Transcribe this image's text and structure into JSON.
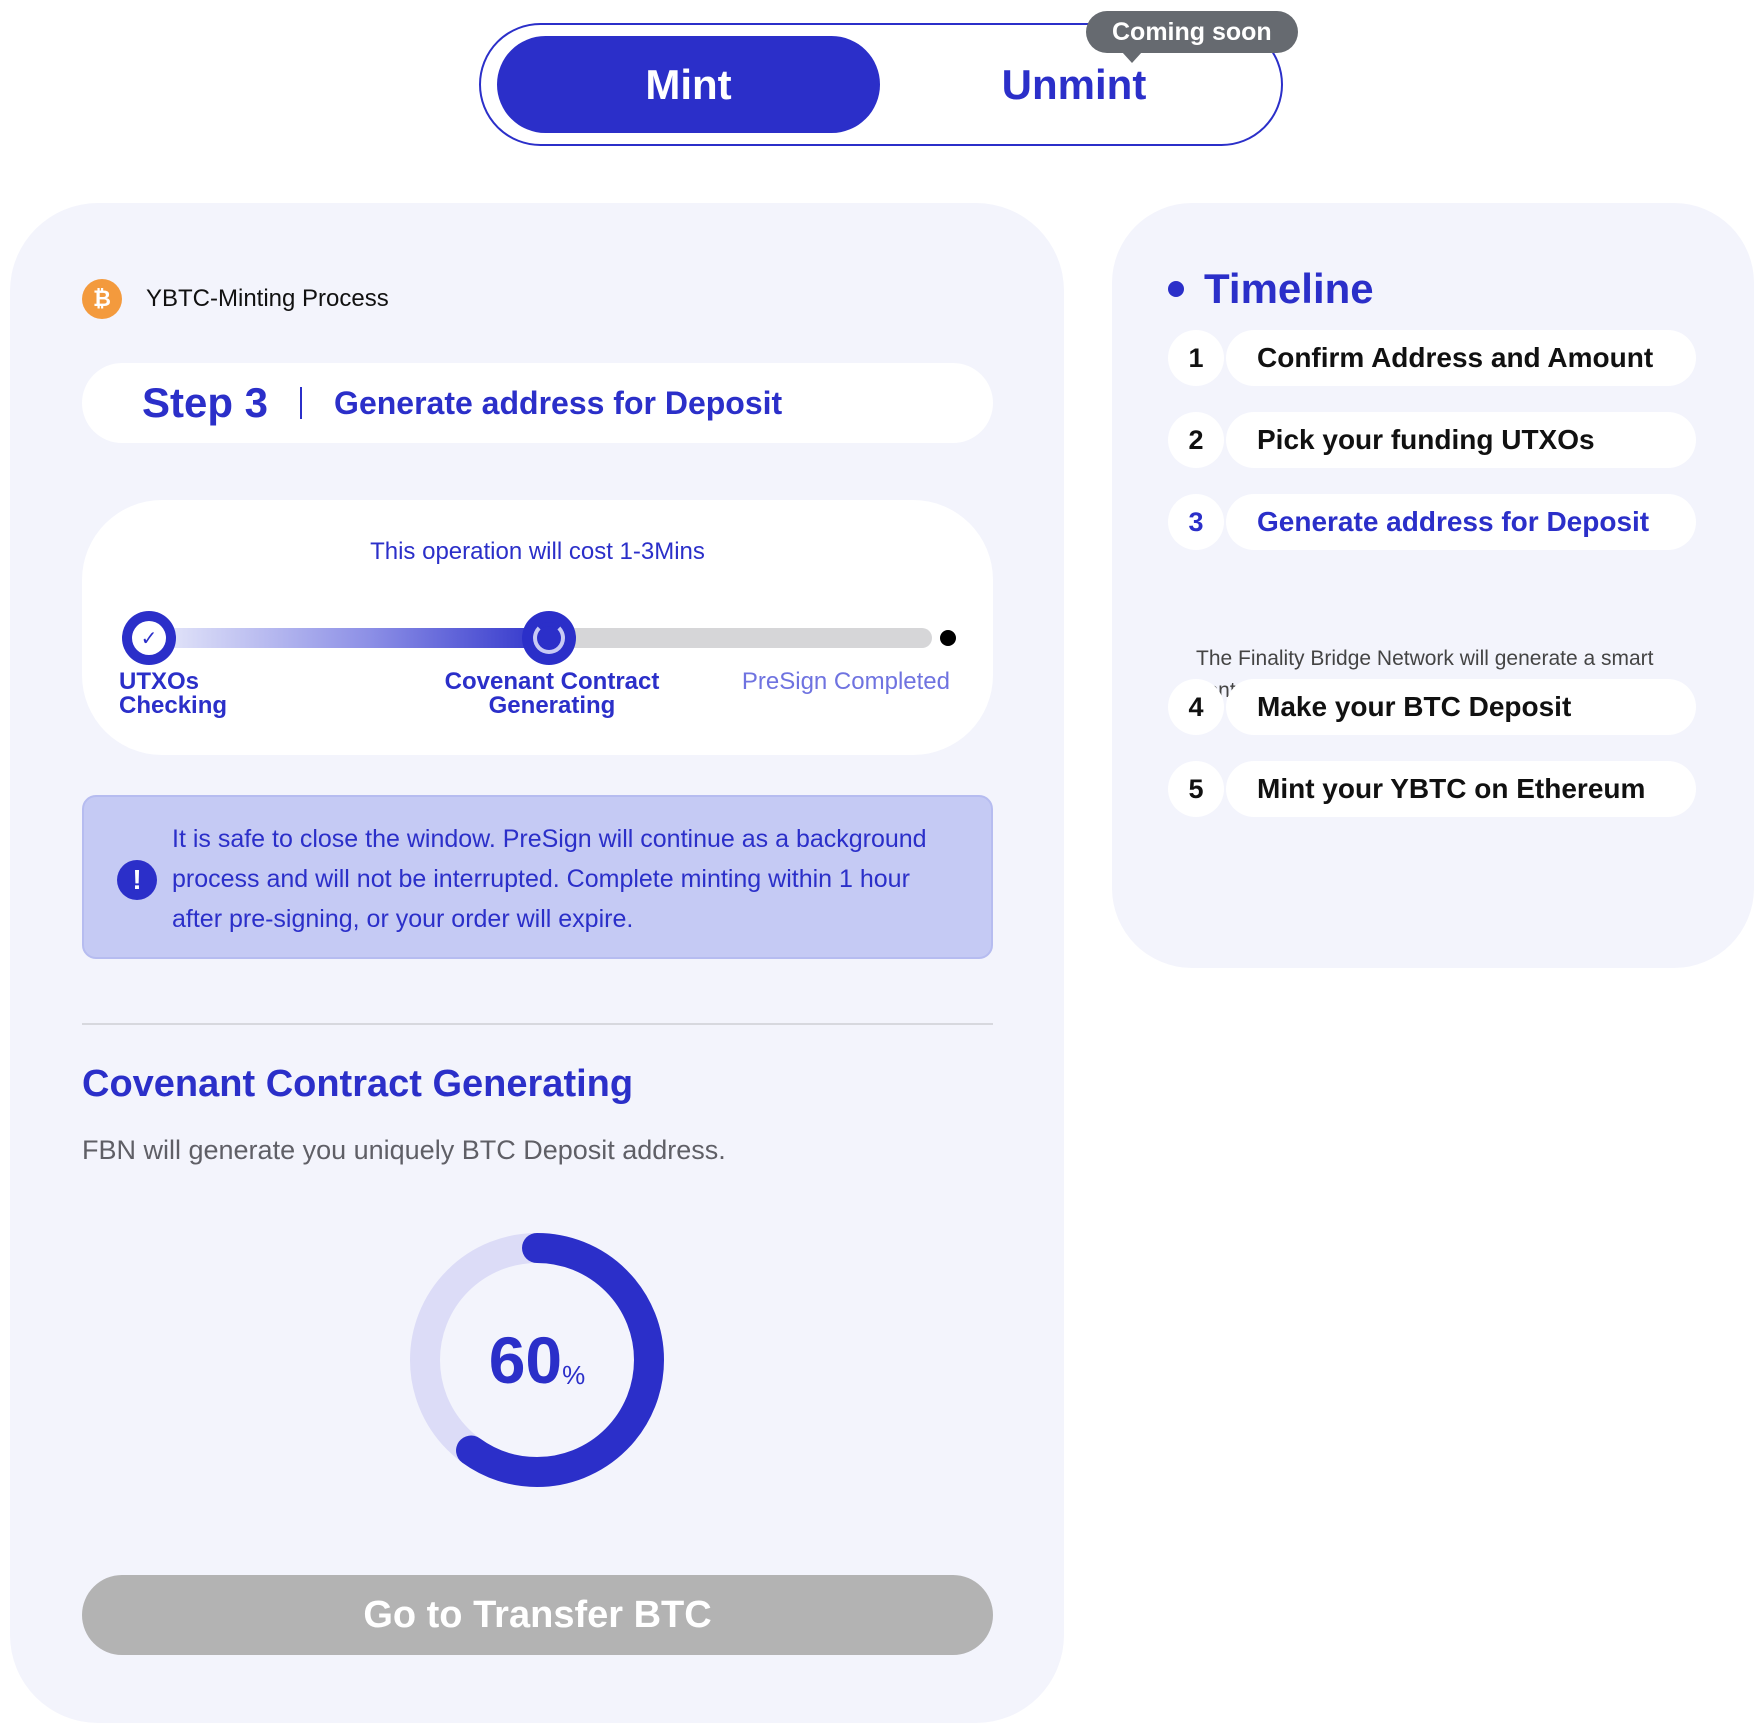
{
  "mode_switch": {
    "mint_label": "Mint",
    "unmint_label": "Unmint",
    "coming_soon_badge": "Coming soon",
    "active": "Mint"
  },
  "process": {
    "title": "YBTC-Minting Process",
    "coin_icon": "bitcoin-icon",
    "step_number": "Step 3",
    "step_title": "Generate address for Deposit",
    "cost_text": "This operation will cost 1-3Mins",
    "stages": [
      {
        "label": "UTXOs Checking",
        "state": "done"
      },
      {
        "label": "Covenant Contract Generating",
        "state": "active"
      },
      {
        "label": "PreSign Completed",
        "state": "pending"
      }
    ],
    "notice_text": "It is safe to close the window. PreSign will continue as a background process and will not be interrupted. Complete minting within 1 hour after pre-signing, or your order will expire.",
    "section_title": "Covenant Contract Generating",
    "section_desc": "FBN will generate you uniquely BTC Deposit address.",
    "progress_value": 60,
    "progress_unit": "%",
    "button_label": "Go to Transfer BTC"
  },
  "timeline": {
    "title": "Timeline",
    "items": [
      {
        "number": "1",
        "label": "Confirm Address and Amount"
      },
      {
        "number": "2",
        "label": "Pick your funding UTXOs"
      },
      {
        "number": "3",
        "label": "Generate address for Deposit",
        "active": true
      },
      {
        "number": "4",
        "label": "Make your BTC Deposit"
      },
      {
        "number": "5",
        "label": "Mint your YBTC on Ethereum"
      }
    ],
    "active_description": "The Finality Bridge Network will generate a smart contract according to your peg-in request."
  },
  "colors": {
    "accent": "#2b2fc9",
    "panel_bg": "#f3f4fc",
    "notice_bg": "#c5caf4",
    "disabled_button": "#b3b3b3",
    "bitcoin_orange": "#f39a3d"
  }
}
